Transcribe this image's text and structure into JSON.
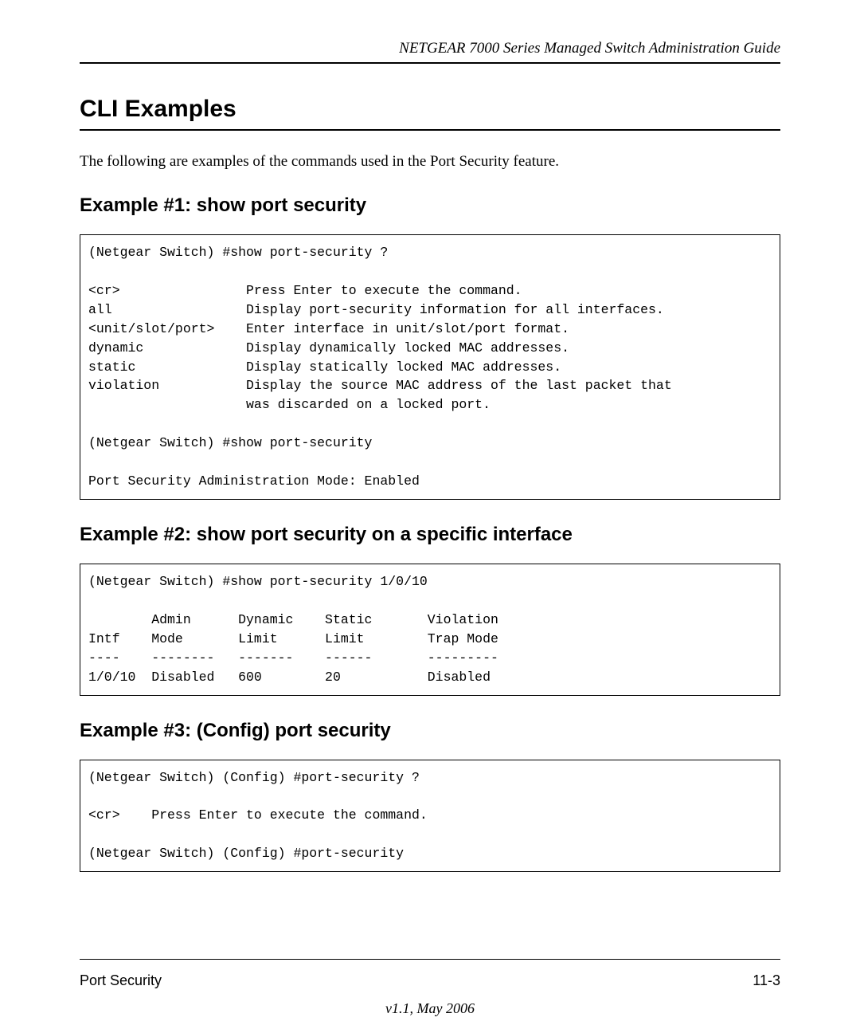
{
  "header_title": "NETGEAR 7000  Series Managed Switch Administration Guide",
  "section_title": "CLI Examples",
  "intro_text": "The following are examples of the commands used in the Port Security feature.",
  "example1": {
    "title": "Example #1: show port security",
    "code": "(Netgear Switch) #show port-security ?\n\n<cr>                Press Enter to execute the command.\nall                 Display port-security information for all interfaces.\n<unit/slot/port>    Enter interface in unit/slot/port format.\ndynamic             Display dynamically locked MAC addresses.\nstatic              Display statically locked MAC addresses.\nviolation           Display the source MAC address of the last packet that\n                    was discarded on a locked port.\n\n(Netgear Switch) #show port-security\n\nPort Security Administration Mode: Enabled"
  },
  "example2": {
    "title": "Example #2: show port security on a specific interface",
    "code": "(Netgear Switch) #show port-security 1/0/10\n\n        Admin      Dynamic    Static       Violation\nIntf    Mode       Limit      Limit        Trap Mode\n----    --------   -------    ------       ---------\n1/0/10  Disabled   600        20           Disabled"
  },
  "example3": {
    "title": "Example #3: (Config) port security",
    "code": "(Netgear Switch) (Config) #port-security ?\n\n<cr>    Press Enter to execute the command.\n\n(Netgear Switch) (Config) #port-security\n"
  },
  "footer": {
    "left": "Port Security",
    "right": "11-3",
    "version": "v1.1, May 2006"
  }
}
